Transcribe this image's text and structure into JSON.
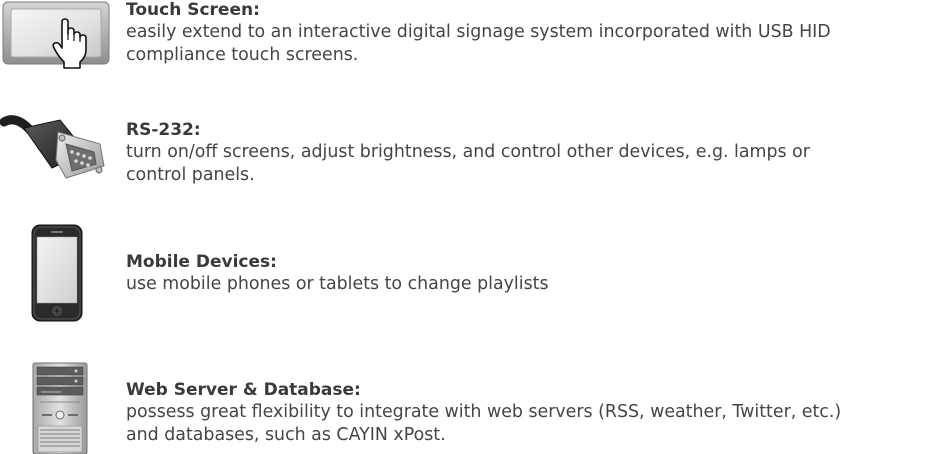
{
  "features": [
    {
      "icon": "touch-screen-icon",
      "title": "Touch Screen:",
      "description": "easily extend to an interactive digital signage system incorporated with USB HID\ncompliance touch screens."
    },
    {
      "icon": "serial-connector-icon",
      "title": "RS-232:",
      "description": "turn on/off screens, adjust brightness, and control other devices, e.g. lamps or\ncontrol panels."
    },
    {
      "icon": "mobile-phone-icon",
      "title": "Mobile Devices:",
      "description": "use mobile phones or tablets to change playlists"
    },
    {
      "icon": "server-tower-icon",
      "title": "Web Server & Database:",
      "description": "possess great flexibility to integrate with web servers (RSS, weather, Twitter, etc.)\nand databases, such as CAYIN xPost."
    }
  ]
}
